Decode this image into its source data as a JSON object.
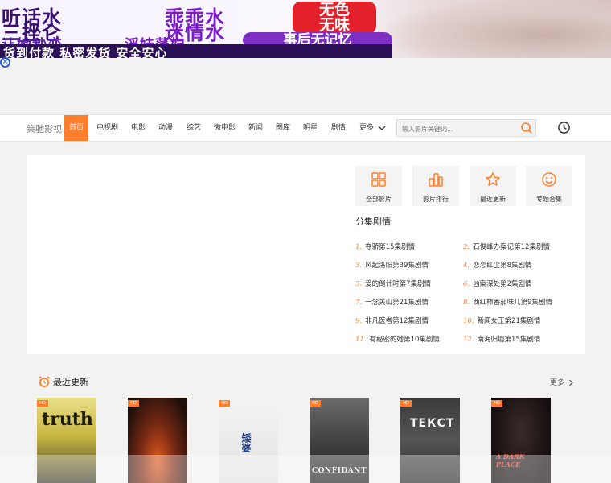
{
  "banner": {
    "line1a": "听话水",
    "line2a": "三挫仑",
    "line3a": "让她秒变",
    "line1b": "乖乖水",
    "line2b": "迷情水",
    "line3b": "淫娃荡妇",
    "redbox": [
      "无色",
      "无味"
    ],
    "pill": "事后无记忆",
    "strip": "货到付款 私密发货 安全安心"
  },
  "nav": {
    "logo": "策驰影视",
    "items": [
      "首页",
      "电视剧",
      "电影",
      "动漫",
      "综艺",
      "微电影",
      "新闻",
      "图库",
      "明星",
      "剧情",
      "更多"
    ],
    "search_placeholder": "输入影片关键词..."
  },
  "quicklinks": [
    "全部影片",
    "影片排行",
    "最近更新",
    "专题合集"
  ],
  "episodes": {
    "title": "分集剧情",
    "list": [
      {
        "n": "1.",
        "t": "夺骄第15集剧情"
      },
      {
        "n": "2.",
        "t": "石俊峰办案记第12集剧情"
      },
      {
        "n": "3.",
        "t": "风起洛阳第39集剧情"
      },
      {
        "n": "4.",
        "t": "恋恋红尘第8集剧情"
      },
      {
        "n": "5.",
        "t": "爱的倒计时第7集剧情"
      },
      {
        "n": "6.",
        "t": "凶案深处第2集剧情"
      },
      {
        "n": "7.",
        "t": "一念关山第21集剧情"
      },
      {
        "n": "8.",
        "t": "西红柿番茄味儿第9集剧情"
      },
      {
        "n": "9.",
        "t": "非凡医者第12集剧情"
      },
      {
        "n": "10.",
        "t": "新闻女王第21集剧情"
      },
      {
        "n": "11.",
        "t": "有秘密的她第10集剧情"
      },
      {
        "n": "12.",
        "t": "南海归墟第15集剧情"
      }
    ]
  },
  "recent": {
    "title": "最近更新",
    "more": "更多",
    "posters": [
      {
        "title": "truth",
        "badge": "HD",
        "bg": "#c9b84a"
      },
      {
        "title": "",
        "badge": "HD",
        "bg": "#5a2a1a"
      },
      {
        "title": "矮婆",
        "badge": "HD",
        "bg": "#e8e8e8"
      },
      {
        "title": "CONFIDANT",
        "badge": "HD",
        "bg": "#4a4a4a"
      },
      {
        "title": "ТЕКСТ",
        "badge": "HD",
        "bg": "#2e2e2e"
      },
      {
        "title": "A DARK PLACE",
        "badge": "HD",
        "bg": "#1c1414"
      }
    ]
  },
  "colors": {
    "accent": "#fe7e2d",
    "banner_purple": "#3a0f70",
    "banner_red": "#e4202a"
  }
}
